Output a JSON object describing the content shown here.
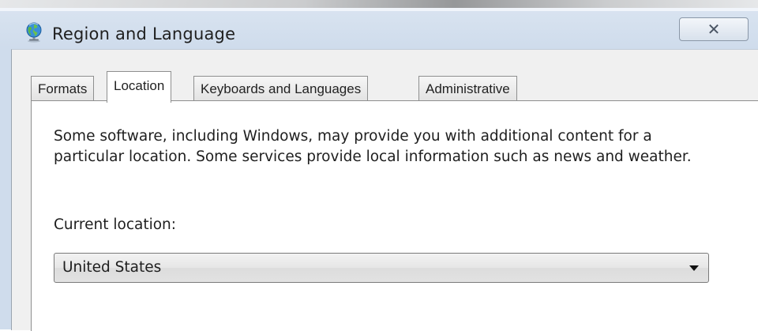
{
  "window": {
    "title": "Region and Language",
    "close_glyph": "✕",
    "app_icon": "globe-icon"
  },
  "tabs": [
    {
      "label": "Formats",
      "active": false
    },
    {
      "label": "Location",
      "active": true
    },
    {
      "label": "Keyboards and Languages",
      "active": false
    },
    {
      "label": "Administrative",
      "active": false
    }
  ],
  "location_tab": {
    "description": "Some software, including Windows, may provide you with additional content for a particular location. Some services provide local information such as news and weather.",
    "current_location_label": "Current location:",
    "current_location_value": "United States"
  }
}
